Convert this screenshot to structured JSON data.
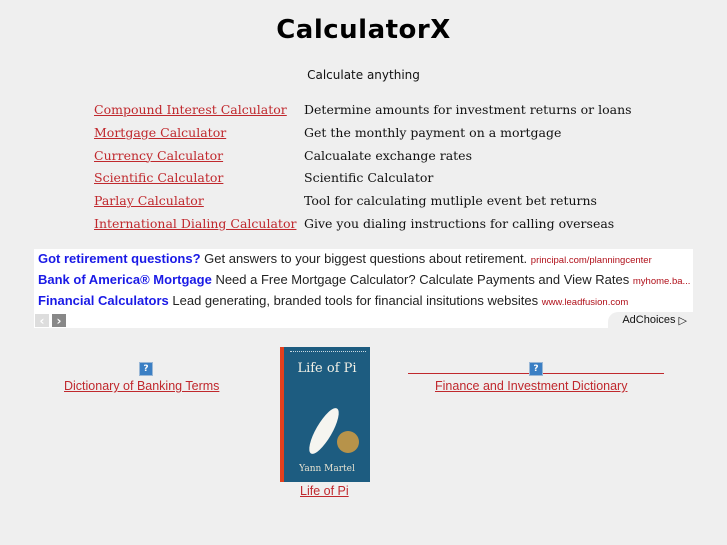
{
  "header": {
    "title": "CalculatorX",
    "subtitle": "Calculate anything"
  },
  "calculators": [
    {
      "label": "Compound Interest Calculator",
      "description": "Determine amounts for investment returns or loans"
    },
    {
      "label": "Mortgage Calculator",
      "description": "Get the monthly payment on a mortgage"
    },
    {
      "label": "Currency Calculator",
      "description": "Calcualate exchange rates"
    },
    {
      "label": "Scientific Calculator",
      "description": "Scientific Calculator"
    },
    {
      "label": "Parlay Calculator",
      "description": "Tool for calculating mutliple event bet returns"
    },
    {
      "label": "International Dialing Calculator",
      "description": "Give you dialing instructions for calling overseas"
    }
  ],
  "ads": {
    "items": [
      {
        "title": "Got retirement questions?",
        "text": "Get answers to your biggest questions about retirement.",
        "url": "principal.com/planningcenter"
      },
      {
        "title": "Bank of America® Mortgage",
        "text": "Need a Free Mortgage Calculator? Calculate Payments and View Rates",
        "url": "myhome.ba..."
      },
      {
        "title": "Financial Calculators",
        "text": "Lead generating, branded tools for financial insitutions websites",
        "url": "www.leadfusion.com"
      }
    ],
    "prev_glyph": "‹",
    "next_glyph": "›",
    "adchoices_label": "AdChoices",
    "adchoices_glyph": "▷"
  },
  "bottom": {
    "help_glyph": "?",
    "left_link": "Dictionary of Banking Terms",
    "book": {
      "title": "Life of Pi",
      "author": "Yann Martel",
      "caption": "Life of Pi"
    },
    "right_link": "Finance and Investment Dictionary"
  }
}
